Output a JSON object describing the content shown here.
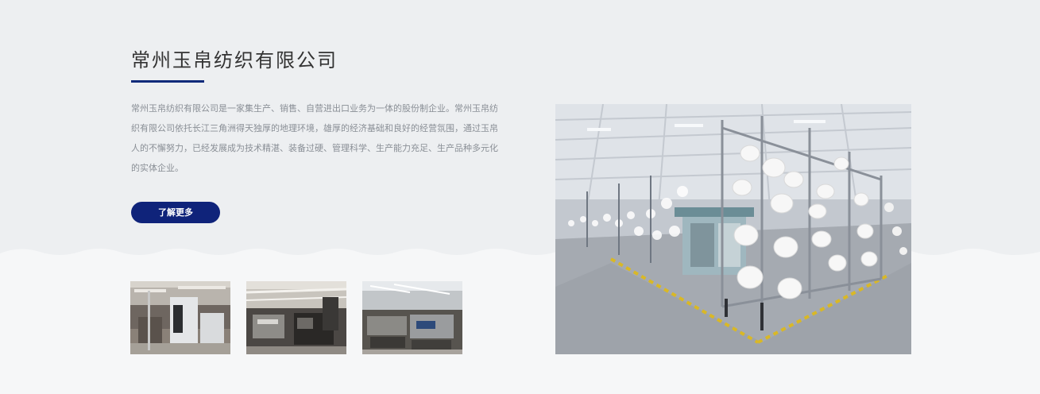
{
  "intro": {
    "title": "常州玉帛纺织有限公司",
    "description": "常州玉帛纺织有限公司是一家集生产、销售、自营进出口业务为一体的股份制企业。常州玉帛纺织有限公司依托长江三角洲得天独厚的地理环境，雄厚的经济基础和良好的经营氛围，通过玉帛人的不懈努力，已经发展成为技术精湛、装备过硬、管理科学、生产能力充足、生产品种多元化的实体企业。",
    "more_button_label": "了解更多"
  },
  "colors": {
    "accent": "#0f237a",
    "title": "#333333",
    "body_text": "#8a8f96",
    "top_background": "#edeff1",
    "bottom_background": "#f6f7f8"
  },
  "gallery": {
    "thumbnails": [
      {
        "alt": "factory-thumbnail-1"
      },
      {
        "alt": "factory-thumbnail-2"
      },
      {
        "alt": "factory-thumbnail-3"
      }
    ],
    "main_photo": {
      "alt": "knitting-machine-workshop"
    }
  }
}
